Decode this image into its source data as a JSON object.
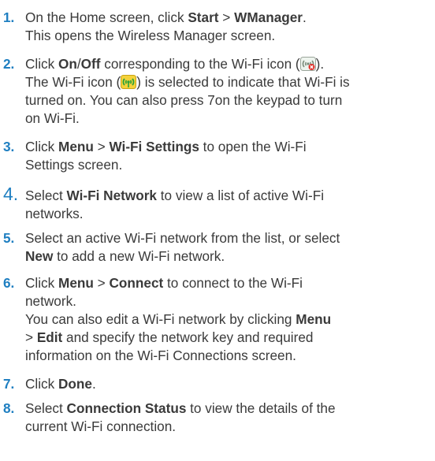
{
  "steps": [
    {
      "num": "1.",
      "lines": [
        [
          {
            "t": "On the Home screen, click "
          },
          {
            "t": "Start",
            "b": true
          },
          {
            "t": " > "
          },
          {
            "t": "WManager",
            "b": true
          },
          {
            "t": "."
          }
        ],
        [
          {
            "t": "This opens the Wireless Manager screen."
          }
        ]
      ]
    },
    {
      "num": "2.",
      "lines": [
        [
          {
            "t": "Click "
          },
          {
            "t": "On",
            "b": true
          },
          {
            "t": "/"
          },
          {
            "t": "Off",
            "b": true
          },
          {
            "t": " corresponding to the Wi-Fi icon ("
          },
          {
            "icon": "wifi-off-icon"
          },
          {
            "t": ")."
          }
        ],
        [
          {
            "t": "The Wi-Fi icon ("
          },
          {
            "icon": "wifi-on-icon"
          },
          {
            "t": ") is selected to indicate that Wi-Fi is"
          }
        ],
        [
          {
            "t": "turned on. You can also press 7on the keypad to turn"
          }
        ],
        [
          {
            "t": "on Wi-Fi."
          }
        ]
      ]
    },
    {
      "num": "3.",
      "lines": [
        [
          {
            "t": "Click "
          },
          {
            "t": "Menu",
            "b": true
          },
          {
            "t": " > "
          },
          {
            "t": "Wi-Fi Settings",
            "b": true
          },
          {
            "t": " to open the Wi-Fi"
          }
        ],
        [
          {
            "t": "Settings screen."
          }
        ]
      ]
    },
    {
      "num": "4.",
      "big": true,
      "lines": [
        [
          {
            "t": "Select "
          },
          {
            "t": "Wi-Fi Network",
            "b": true
          },
          {
            "t": " to view a list of active Wi-Fi"
          }
        ],
        [
          {
            "t": "networks."
          }
        ]
      ]
    },
    {
      "num": "5.",
      "lines": [
        [
          {
            "t": "Select an active Wi-Fi network from the list, or select"
          }
        ],
        [
          {
            "t": "New",
            "b": true
          },
          {
            "t": " to add a new Wi-Fi network."
          }
        ]
      ]
    },
    {
      "num": "6.",
      "lines": [
        [
          {
            "t": "Click "
          },
          {
            "t": "Menu",
            "b": true
          },
          {
            "t": " > "
          },
          {
            "t": "Connect",
            "b": true
          },
          {
            "t": " to connect to the Wi-Fi"
          }
        ],
        [
          {
            "t": "network."
          }
        ],
        [
          {
            "t": "You can also edit a Wi-Fi network by clicking "
          },
          {
            "t": "Menu",
            "b": true
          }
        ],
        [
          {
            "t": "> "
          },
          {
            "t": "Edit",
            "b": true
          },
          {
            "t": " and specify the network key and required"
          }
        ],
        [
          {
            "t": "information on the Wi-Fi Connections screen."
          }
        ]
      ]
    },
    {
      "num": "7.",
      "lines": [
        [
          {
            "t": "Click "
          },
          {
            "t": "Done",
            "b": true
          },
          {
            "t": "."
          }
        ]
      ]
    },
    {
      "num": "8.",
      "lines": [
        [
          {
            "t": "Select "
          },
          {
            "t": "Connection Status",
            "b": true
          },
          {
            "t": " to view the details of the"
          }
        ],
        [
          {
            "t": "current Wi-Fi connection."
          }
        ]
      ]
    }
  ]
}
